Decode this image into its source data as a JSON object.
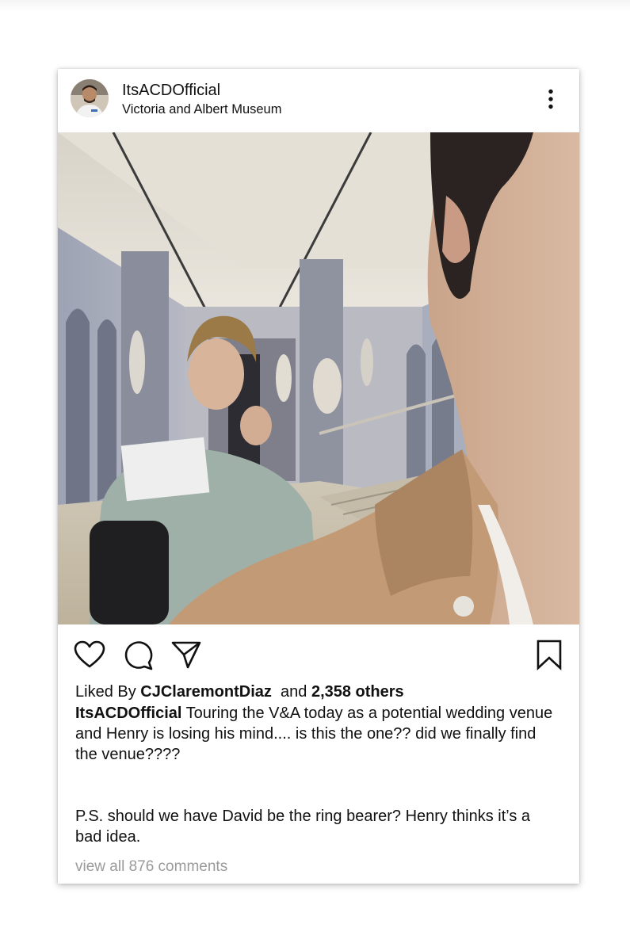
{
  "post": {
    "username": "ItsACDOfficial",
    "location": "Victoria and Albert Museum",
    "liked_by_prefix": "Liked By",
    "liked_by_user": "CJClaremontDiaz",
    "liked_by_and": "and",
    "liked_by_count": "2,358 others",
    "caption_user": "ItsACDOfficial",
    "caption_text": "Touring the V&A today as a potential wedding venue and Henry is losing his mind.... is this the one?? did we finally find the venue????",
    "ps_text": "P.S. should we have David be the ring bearer? Henry thinks it’s a bad idea.",
    "view_all_comments": "view all 876 comments"
  },
  "icons": {
    "more": "more-vertical-icon",
    "like": "heart-icon",
    "comment": "comment-bubble-icon",
    "share": "paper-plane-icon",
    "save": "bookmark-icon"
  },
  "colors": {
    "text": "#111111",
    "muted": "#9a9a9a",
    "card": "#ffffff"
  }
}
